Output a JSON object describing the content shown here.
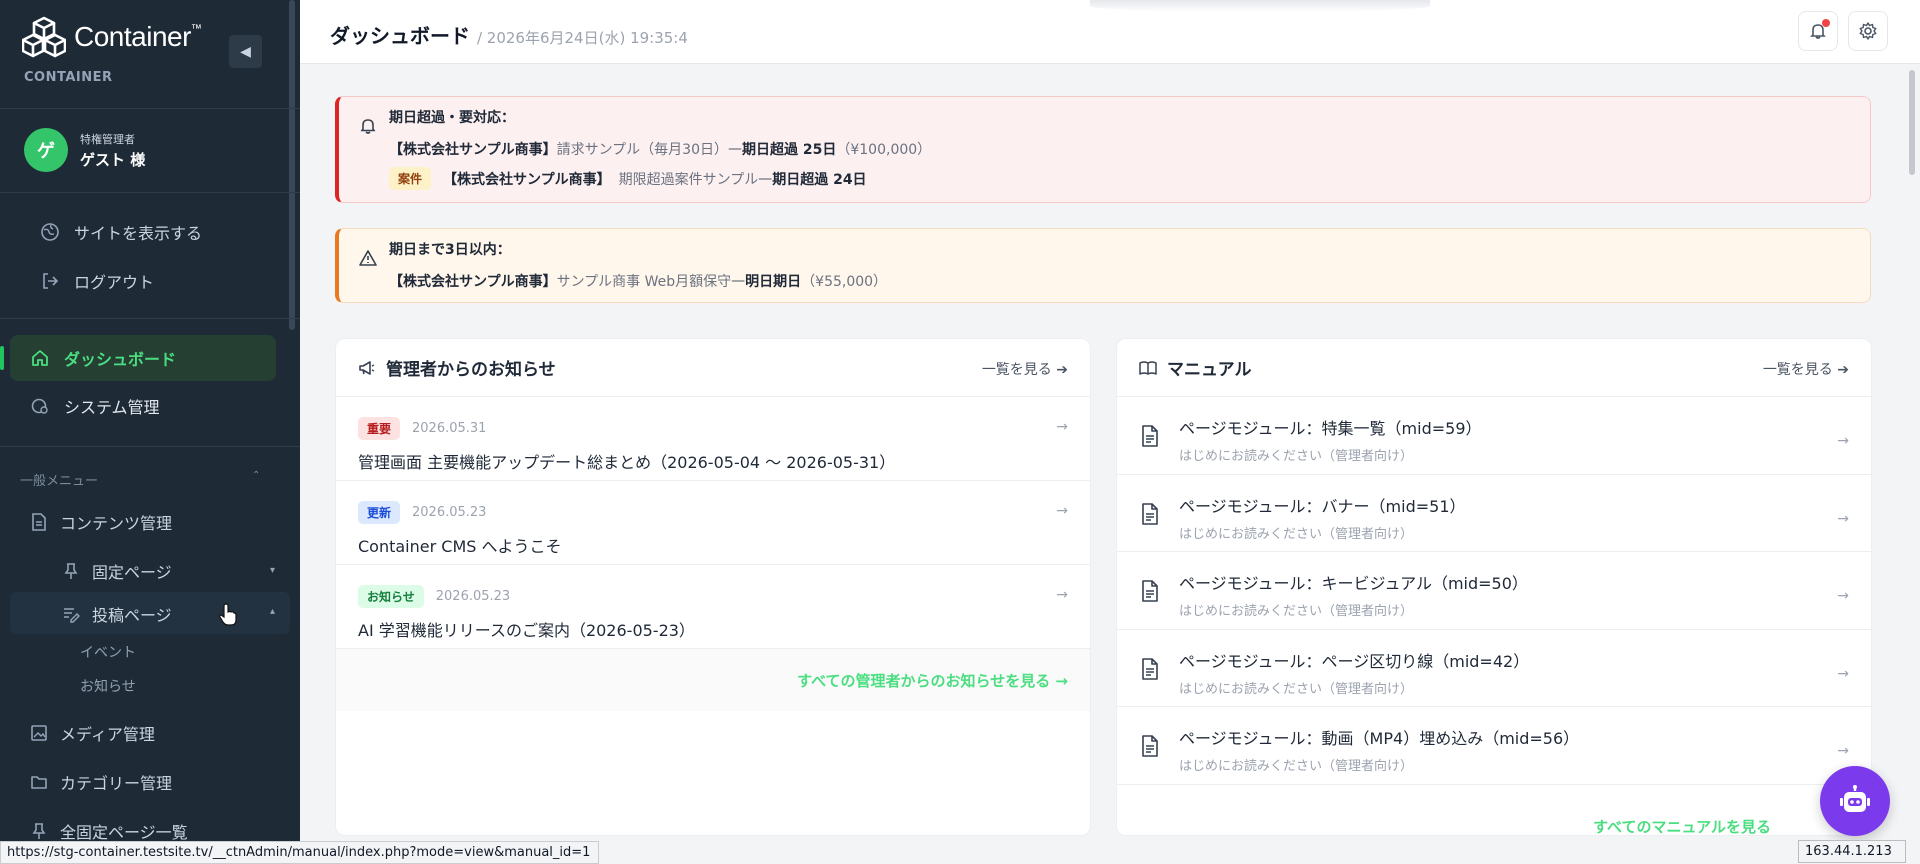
{
  "brand": {
    "name": "Container",
    "tm": "™",
    "sub": "CONTAINER"
  },
  "user": {
    "initial": "ゲ",
    "role": "特権管理者",
    "name": "ゲスト 様"
  },
  "sidebar": {
    "links": [
      {
        "label": "サイトを表示する",
        "icon": "globe-icon"
      },
      {
        "label": "ログアウト",
        "icon": "logout-icon"
      }
    ],
    "nav": [
      {
        "label": "ダッシュボード",
        "icon": "home-icon",
        "active": true
      },
      {
        "label": "システム管理",
        "icon": "system-gear-icon",
        "active": false
      }
    ],
    "section_label": "一般メニュー",
    "content": {
      "label": "コンテンツ管理",
      "fixed_pages": "固定ページ",
      "post_pages": "投稿ページ",
      "leaves": [
        "イベント",
        "お知らせ"
      ]
    },
    "more": [
      {
        "label": "メディア管理",
        "icon": "image-icon"
      },
      {
        "label": "カテゴリー管理",
        "icon": "folder-icon"
      },
      {
        "label": "全固定ページ一覧",
        "icon": "pin-icon"
      }
    ]
  },
  "header": {
    "title": "ダッシュボード",
    "date": "/ 2026年6月24日(水) 19:35:4"
  },
  "alerts": {
    "overdue": {
      "title": "期日超過・要対応：",
      "line1": {
        "client": "【株式会社サンプル商事】",
        "item": "請求サンプル（毎月30日）",
        "dash": " — ",
        "status": "期日超過 25日",
        "amount": "（¥100,000）"
      },
      "line2": {
        "tag": "案件",
        "client": "【株式会社サンプル商事】",
        "item": "期限超過案件サンプル",
        "dash": " — ",
        "status": "期日超過 24日"
      }
    },
    "soon": {
      "title": "期日まで3日以内：",
      "line1": {
        "client": "【株式会社サンプル商事】",
        "item": "サンプル商事 Web月額保守",
        "dash": " — ",
        "status": "明日期日",
        "amount": "（¥55,000）"
      }
    }
  },
  "news": {
    "title": "管理者からのお知らせ",
    "see_all": "一覧を見る",
    "items": [
      {
        "tag": "重要",
        "tag_type": "important",
        "date": "2026.05.31",
        "title": "管理画面 主要機能アップデート総まとめ（2026-05-04 〜 2026-05-31）"
      },
      {
        "tag": "更新",
        "tag_type": "update",
        "date": "2026.05.23",
        "title": "Container CMS へようこそ"
      },
      {
        "tag": "お知らせ",
        "tag_type": "notice",
        "date": "2026.05.23",
        "title": "AI 学習機能リリースのご案内（2026-05-23）"
      }
    ],
    "footer": "すべての管理者からのお知らせを見る →"
  },
  "manual": {
    "title": "マニュアル",
    "see_all": "一覧を見る",
    "items": [
      {
        "title": "ページモジュール：特集一覧（mid=59）",
        "sub": "はじめにお読みください（管理者向け）"
      },
      {
        "title": "ページモジュール：バナー（mid=51）",
        "sub": "はじめにお読みください（管理者向け）"
      },
      {
        "title": "ページモジュール：キービジュアル（mid=50）",
        "sub": "はじめにお読みください（管理者向け）"
      },
      {
        "title": "ページモジュール：ページ区切り線（mid=42）",
        "sub": "はじめにお読みください（管理者向け）"
      },
      {
        "title": "ページモジュール：動画（MP4）埋め込み（mid=56）",
        "sub": "はじめにお読みください（管理者向け）"
      }
    ],
    "footer": "すべてのマニュアルを見る"
  },
  "arrow": "→",
  "status_bar": {
    "url": "https://stg-container.testsite.tv/__ctnAdmin/manual/index.php?mode=view&manual_id=1",
    "ip": "163.44.1.213"
  },
  "colors": {
    "sidebar_bg": "#1e2a36",
    "accent_green": "#4ade80",
    "alert_red": "#dc2626",
    "alert_orange": "#ea7a21",
    "fab_purple": "#7c3aed"
  }
}
